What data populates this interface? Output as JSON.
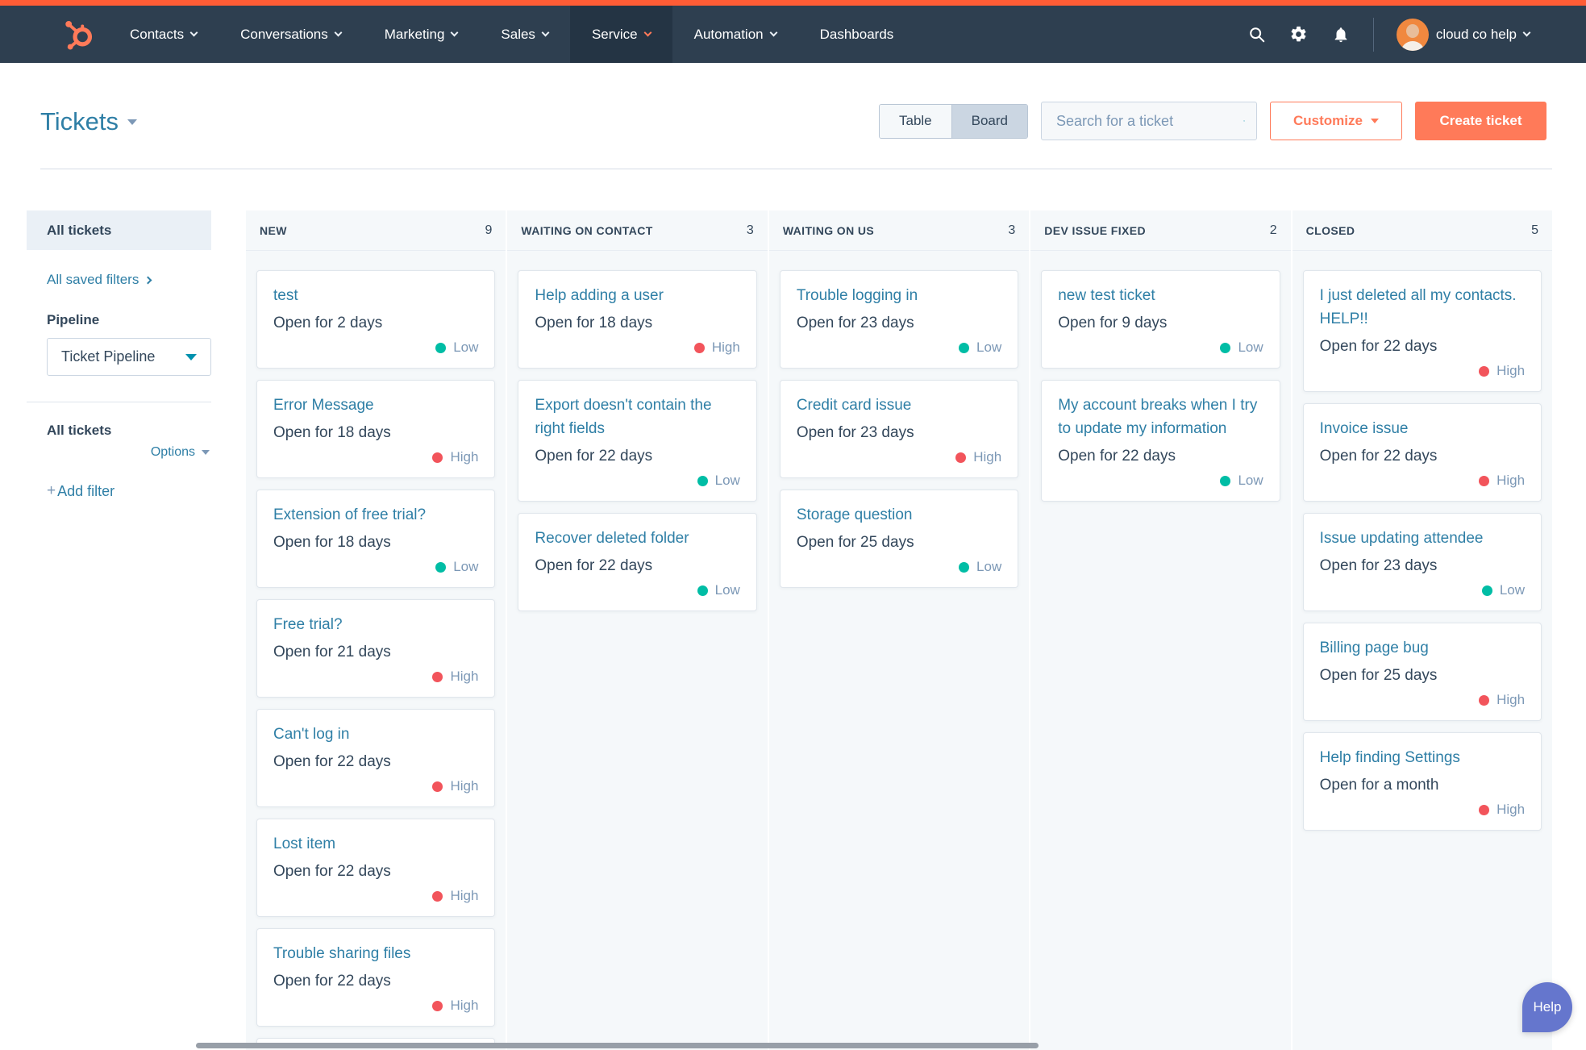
{
  "nav": {
    "items": [
      {
        "id": "contacts",
        "label": "Contacts",
        "caret": true,
        "active": false
      },
      {
        "id": "conversations",
        "label": "Conversations",
        "caret": true,
        "active": false
      },
      {
        "id": "marketing",
        "label": "Marketing",
        "caret": true,
        "active": false
      },
      {
        "id": "sales",
        "label": "Sales",
        "caret": true,
        "active": false
      },
      {
        "id": "service",
        "label": "Service",
        "caret": true,
        "active": true
      },
      {
        "id": "automation",
        "label": "Automation",
        "caret": true,
        "active": false
      },
      {
        "id": "dashboards",
        "label": "Dashboards",
        "caret": false,
        "active": false
      }
    ],
    "account": "cloud co help"
  },
  "header": {
    "title": "Tickets",
    "table_label": "Table",
    "board_label": "Board",
    "selected_view": "Board",
    "search_placeholder": "Search for a ticket",
    "customize_label": "Customize",
    "create_ticket_label": "Create ticket"
  },
  "sidebar": {
    "selected_item": "All tickets",
    "saved_filters_link": "All saved filters",
    "pipeline_label": "Pipeline",
    "pipeline_value": "Ticket Pipeline",
    "filters_heading": "All tickets",
    "options_label": "Options",
    "add_filter_plus": "+",
    "add_filter_label": "Add filter"
  },
  "board": {
    "columns": [
      {
        "id": "new",
        "name": "NEW",
        "count": "9",
        "cards": [
          {
            "title": "test",
            "age": "Open for 2 days",
            "priority": "Low"
          },
          {
            "title": "Error Message",
            "age": "Open for 18 days",
            "priority": "High"
          },
          {
            "title": "Extension of free trial?",
            "age": "Open for 18 days",
            "priority": "Low"
          },
          {
            "title": "Free trial?",
            "age": "Open for 21 days",
            "priority": "High"
          },
          {
            "title": "Can't log in",
            "age": "Open for 22 days",
            "priority": "High"
          },
          {
            "title": "Lost item",
            "age": "Open for 22 days",
            "priority": "High"
          },
          {
            "title": "Trouble sharing files",
            "age": "Open for 22 days",
            "priority": "High"
          },
          {
            "partial": true
          }
        ]
      },
      {
        "id": "waiting-on-contact",
        "name": "WAITING ON CONTACT",
        "count": "3",
        "cards": [
          {
            "title": "Help adding a user",
            "age": "Open for 18 days",
            "priority": "High"
          },
          {
            "title": "Export doesn't contain the right fields",
            "age": "Open for 22 days",
            "priority": "Low"
          },
          {
            "title": "Recover deleted folder",
            "age": "Open for 22 days",
            "priority": "Low"
          }
        ]
      },
      {
        "id": "waiting-on-us",
        "name": "WAITING ON US",
        "count": "3",
        "cards": [
          {
            "title": "Trouble logging in",
            "age": "Open for 23 days",
            "priority": "Low"
          },
          {
            "title": "Credit card issue",
            "age": "Open for 23 days",
            "priority": "High"
          },
          {
            "title": "Storage question",
            "age": "Open for 25 days",
            "priority": "Low"
          }
        ]
      },
      {
        "id": "dev-issue-fixed",
        "name": "DEV ISSUE FIXED",
        "count": "2",
        "cards": [
          {
            "title": "new test ticket",
            "age": "Open for 9 days",
            "priority": "Low"
          },
          {
            "title": "My account breaks when I try to update my information",
            "age": "Open for 22 days",
            "priority": "Low"
          }
        ]
      },
      {
        "id": "closed",
        "name": "CLOSED",
        "count": "5",
        "cards": [
          {
            "title": "I just deleted all my contacts. HELP!!",
            "age": "Open for 22 days",
            "priority": "High"
          },
          {
            "title": "Invoice issue",
            "age": "Open for 22 days",
            "priority": "High"
          },
          {
            "title": "Issue updating attendee",
            "age": "Open for 23 days",
            "priority": "Low"
          },
          {
            "title": "Billing page bug",
            "age": "Open for 25 days",
            "priority": "High"
          },
          {
            "title": "Help finding Settings",
            "age": "Open for a month",
            "priority": "High"
          }
        ]
      }
    ]
  },
  "help": {
    "label": "Help"
  },
  "colors": {
    "low": "#00bda5",
    "high": "#f2545b",
    "brand_orange": "#ff5c35",
    "button_orange": "#ff7a59",
    "nav_bg": "#2e3f50",
    "link": "#2f7fa6",
    "help_fab": "#6576cd"
  }
}
